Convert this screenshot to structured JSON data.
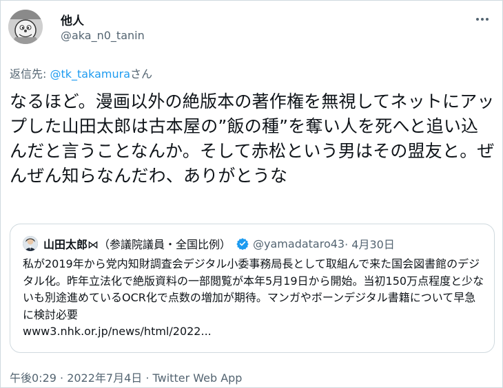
{
  "author": {
    "name": "他人",
    "handle": "@aka_n0_tanin"
  },
  "reply": {
    "prefix": "返信先: ",
    "mention": "@tk_takamura",
    "suffix": "さん"
  },
  "tweet_text": "なるほど。漫画以外の絶版本の著作権を無視してネットにアップした山田太郎は古本屋の”飯の種”を奪い人を死へと追い込んだと言うことなんか。そして赤松という男はその盟友と。ぜんぜん知らなんだわ、ありがとうな",
  "quote": {
    "name": "山田太郎",
    "title": " ⋈（参議院議員・全国比例）",
    "handle": "@yamadataro43",
    "date": " · 4月30日",
    "body": "私が2019年から党内知財調査会デジタル小委事務局長として取組んで来た国会図書館のデジタル化。昨年立法化で絶版資料の一部閲覧が本年5月19日から開始。当初150万点程度と少ないも別途進めているOCR化で点数の増加が期待。マンガやボーンデジタル書籍について早急に検討必要",
    "link": "www3.nhk.or.jp/news/html/2022..."
  },
  "footer": "午後0:29 · 2022年7月4日 · Twitter Web App",
  "icons": [
    "avatar",
    "more-icon",
    "verified-badge-icon"
  ],
  "colors": {
    "link": "#1d9bf0",
    "secondary_text": "#536471",
    "border": "#cfd9de",
    "text": "#0f1419"
  }
}
